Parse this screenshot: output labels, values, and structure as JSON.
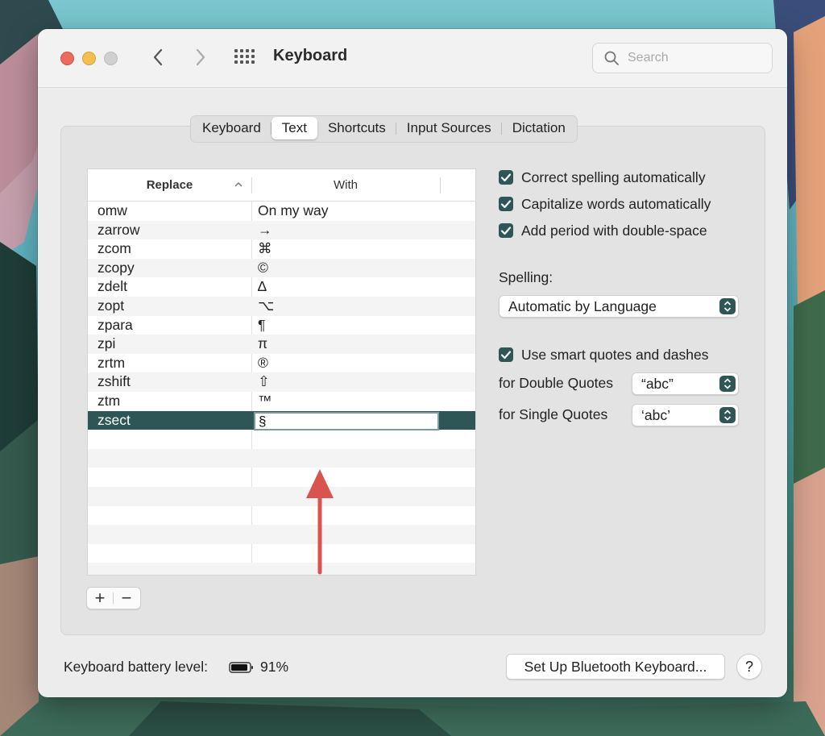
{
  "window": {
    "title": "Keyboard",
    "search_placeholder": "Search"
  },
  "tabs": [
    {
      "label": "Keyboard",
      "active": false
    },
    {
      "label": "Text",
      "active": true
    },
    {
      "label": "Shortcuts",
      "active": false
    },
    {
      "label": "Input Sources",
      "active": false
    },
    {
      "label": "Dictation",
      "active": false
    }
  ],
  "table": {
    "headers": {
      "replace": "Replace",
      "with": "With"
    },
    "rows": [
      {
        "replace": "omw",
        "with": "On my way"
      },
      {
        "replace": "zarrow",
        "with": "→"
      },
      {
        "replace": "zcom",
        "with": "⌘"
      },
      {
        "replace": "zcopy",
        "with": "©"
      },
      {
        "replace": "zdelt",
        "with": "∆"
      },
      {
        "replace": "zopt",
        "with": "⌥"
      },
      {
        "replace": "zpara",
        "with": "¶"
      },
      {
        "replace": "zpi",
        "with": "π"
      },
      {
        "replace": "zrtm",
        "with": "®"
      },
      {
        "replace": "zshift",
        "with": "⇧"
      },
      {
        "replace": "ztm",
        "with": "™"
      },
      {
        "replace": "zsect",
        "with": "§",
        "selected": true
      }
    ],
    "add_label": "+",
    "remove_label": "−"
  },
  "options": {
    "correct_spelling": {
      "label": "Correct spelling automatically",
      "checked": true
    },
    "capitalize_words": {
      "label": "Capitalize words automatically",
      "checked": true
    },
    "add_period": {
      "label": "Add period with double-space",
      "checked": true
    },
    "spelling_label": "Spelling:",
    "spelling_value": "Automatic by Language",
    "smart_quotes": {
      "label": "Use smart quotes and dashes",
      "checked": true
    },
    "double_quotes_label": "for Double Quotes",
    "double_quotes_value": "“abc”",
    "single_quotes_label": "for Single Quotes",
    "single_quotes_value": "‘abc’"
  },
  "footer": {
    "battery_label": "Keyboard battery level:",
    "battery_value": "91%",
    "battery_level": 0.91,
    "bluetooth_button": "Set Up Bluetooth Keyboard...",
    "help_label": "?"
  },
  "colors": {
    "accent": "#2e5656",
    "annotation_arrow": "#d9544f"
  }
}
